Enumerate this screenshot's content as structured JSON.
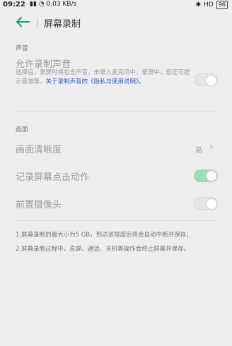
{
  "status": {
    "time": "09:22",
    "signal": "▮▮ ◔ 0.03 KB/s",
    "hd": "HD",
    "battery": "96"
  },
  "header": {
    "title": "屏幕录制"
  },
  "sound": {
    "section": "声音",
    "allow_title": "允许录制声音",
    "allow_desc_1": "选择后，录屏时将包含声音，未录入麦克风中，录屏中，您还可提示音道等。",
    "allow_desc_link": "关于录制声音的《隐私与使用说明》。",
    "allow_toggle": "off"
  },
  "picture": {
    "section": "画面",
    "clarity_title": "画面清晰度",
    "clarity_value": "高",
    "touch_title": "记录屏幕点击动作",
    "touch_toggle": "on",
    "camera_title": "前置摄像头",
    "camera_toggle": "off"
  },
  "notes": [
    "1.屏幕录制的最大小为5 GB，到达该限度后将会自动中断并保存；",
    "2.屏幕录制过程中，息屏、通话、关机等操作会终止屏幕并保存。"
  ]
}
